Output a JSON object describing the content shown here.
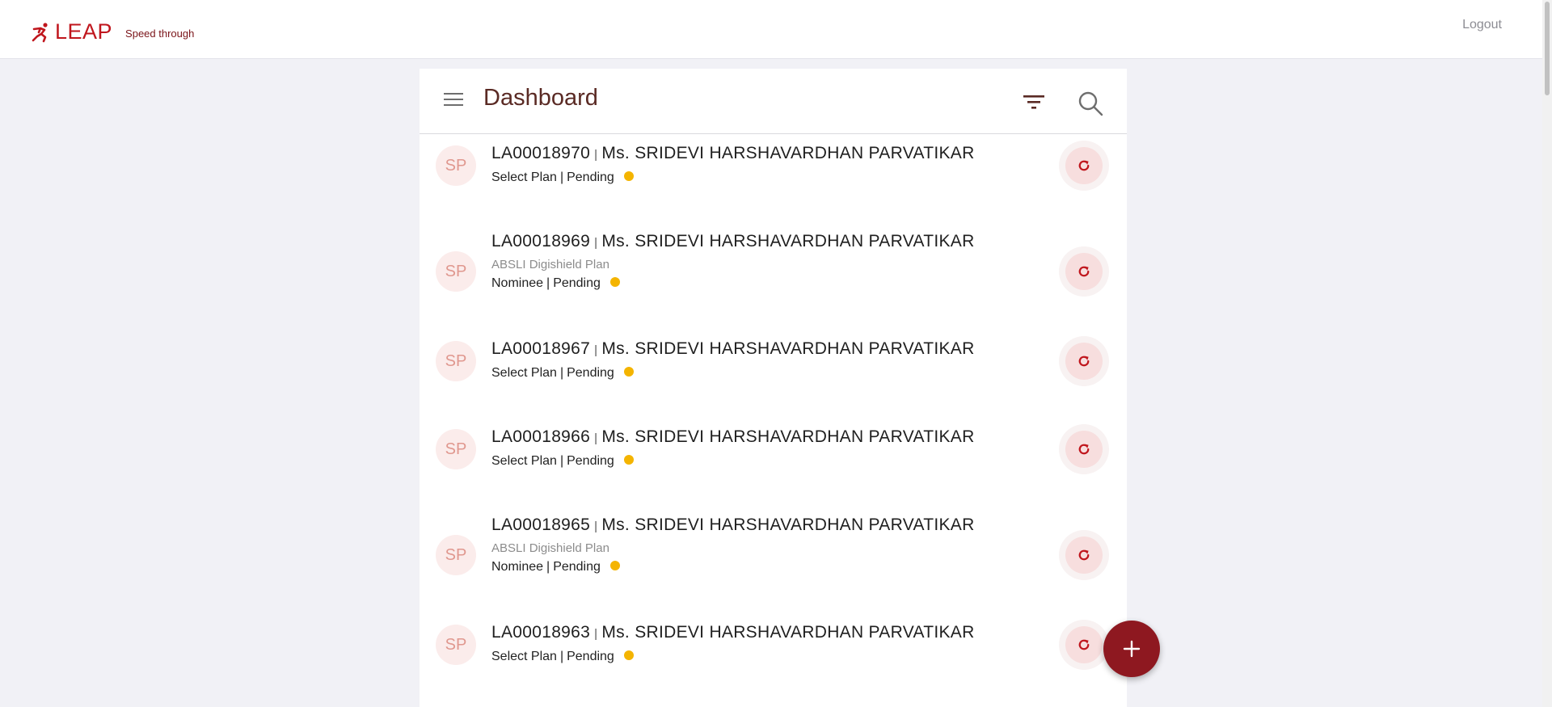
{
  "header": {
    "logo_text": "LEAP",
    "tagline": "Speed through",
    "logout_label": "Logout"
  },
  "panel": {
    "title": "Dashboard"
  },
  "applications": [
    {
      "avatar": "SP",
      "id": "LA00018970",
      "name": "Ms. SRIDEVI HARSHAVARDHAN PARVATIKAR",
      "plan": "",
      "stage": "Select Plan",
      "status": "Pending"
    },
    {
      "avatar": "SP",
      "id": "LA00018969",
      "name": "Ms. SRIDEVI HARSHAVARDHAN PARVATIKAR",
      "plan": "ABSLI Digishield Plan",
      "stage": "Nominee",
      "status": "Pending"
    },
    {
      "avatar": "SP",
      "id": "LA00018967",
      "name": "Ms. SRIDEVI HARSHAVARDHAN PARVATIKAR",
      "plan": "",
      "stage": "Select Plan",
      "status": "Pending"
    },
    {
      "avatar": "SP",
      "id": "LA00018966",
      "name": "Ms. SRIDEVI HARSHAVARDHAN PARVATIKAR",
      "plan": "",
      "stage": "Select Plan",
      "status": "Pending"
    },
    {
      "avatar": "SP",
      "id": "LA00018965",
      "name": "Ms. SRIDEVI HARSHAVARDHAN PARVATIKAR",
      "plan": "ABSLI Digishield Plan",
      "stage": "Nominee",
      "status": "Pending"
    },
    {
      "avatar": "SP",
      "id": "LA00018963",
      "name": "Ms. SRIDEVI HARSHAVARDHAN PARVATIKAR",
      "plan": "",
      "stage": "Select Plan",
      "status": "Pending"
    }
  ],
  "colors": {
    "brand": "#c0161d",
    "fab": "#8e1820",
    "pending_dot": "#f4b400"
  },
  "icons": {
    "menu": "hamburger-icon",
    "filter": "filter-icon",
    "search": "search-icon",
    "refresh": "refresh-icon",
    "add": "plus-icon"
  }
}
